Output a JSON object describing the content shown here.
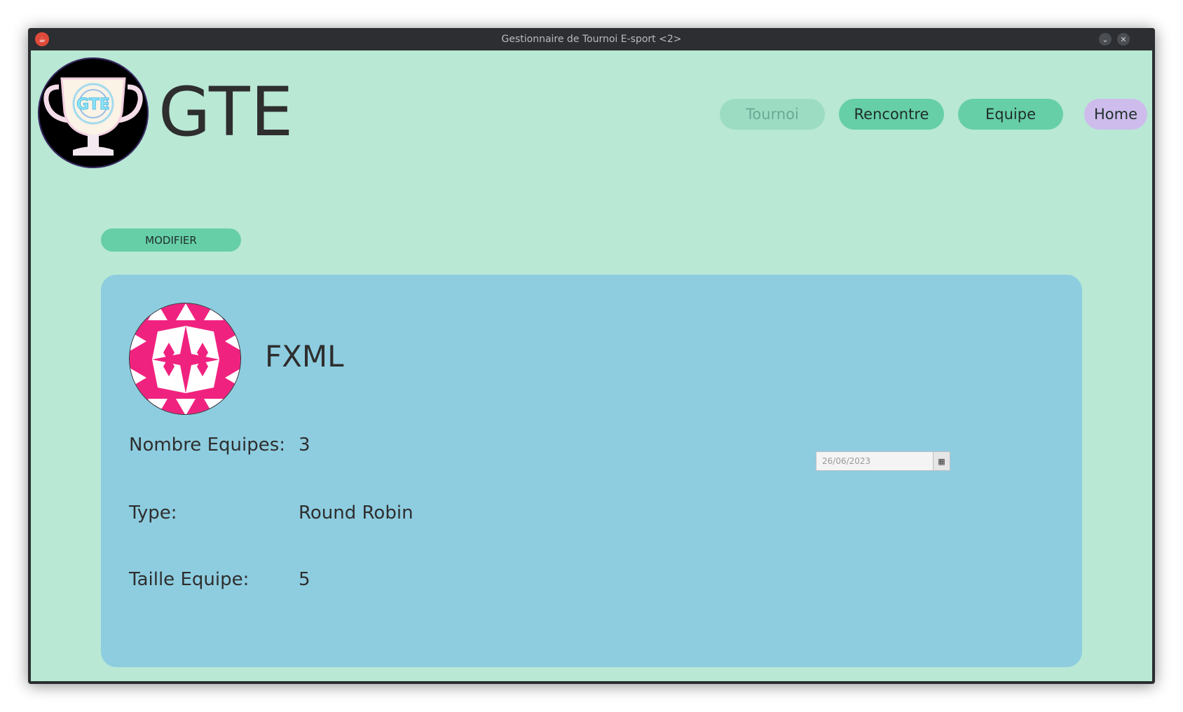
{
  "window": {
    "title": "Gestionnaire de Tournoi E-sport <2>",
    "minimize_icon": "⌄",
    "close_icon": "✕"
  },
  "header": {
    "app_name": "GTE",
    "logo_text": "GTE"
  },
  "nav": {
    "tournoi": "Tournoi",
    "rencontre": "Rencontre",
    "equipe": "Equipe",
    "home": "Home"
  },
  "toolbar": {
    "modifier_label": "MODIFIER"
  },
  "tournament": {
    "name": "FXML",
    "rows": [
      {
        "label": "Nombre Equipes:",
        "value": "3"
      },
      {
        "label": "Type:",
        "value": "Round Robin"
      },
      {
        "label": "Taille Equipe:",
        "value": "5"
      }
    ],
    "date": "26/06/2023"
  },
  "colors": {
    "background": "#b9e8d5",
    "card": "#8ecde0",
    "button": "#66cfa8",
    "home_button": "#cdbcec",
    "avatar_pink": "#f0227f"
  }
}
